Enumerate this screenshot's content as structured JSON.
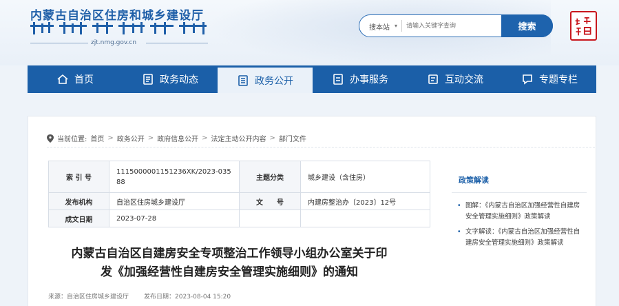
{
  "header": {
    "site_title": "内蒙古自治区住房和城乡建设厅",
    "site_url": "zjt.nmg.gov.cn",
    "seal_text": "内蒙古"
  },
  "search": {
    "scope_label": "搜本站",
    "placeholder": "请输入关键字查询",
    "button_label": "搜索"
  },
  "nav": {
    "items": [
      {
        "label": "首页",
        "icon": "home-icon"
      },
      {
        "label": "政务动态",
        "icon": "document-icon"
      },
      {
        "label": "政务公开",
        "icon": "list-document-icon",
        "active": true
      },
      {
        "label": "办事服务",
        "icon": "service-icon"
      },
      {
        "label": "互动交流",
        "icon": "chat-icon"
      },
      {
        "label": "专题专栏",
        "icon": "topic-icon"
      }
    ]
  },
  "breadcrumb": {
    "prefix": "当前位置:",
    "items": [
      "首页",
      "政务公开",
      "政府信息公开",
      "法定主动公开内容",
      "部门文件"
    ]
  },
  "meta_table": {
    "index_label": "索 引 号",
    "index_value_line1": "1115000001151236XK/2023-035",
    "index_value_line2": "88",
    "category_label": "主题分类",
    "category_value": "城乡建设（含住房）",
    "issuer_label": "发布机构",
    "issuer_value": "自治区住房城乡建设厅",
    "docno_label": "文　　号",
    "docno_value": "内建房整治办〔2023〕12号",
    "date_label": "成文日期",
    "date_value": "2023-07-28"
  },
  "document": {
    "title_line1": "内蒙古自治区自建房安全专项整治工作领导小组办公室关于印",
    "title_line2": "发《加强经营性自建房安全管理实施细则》的通知",
    "source": "来源：自治区住房城乡建设厅",
    "published": "发布日期：2023-08-04 15:20"
  },
  "sidebar": {
    "title": "政策解读",
    "items": [
      "图解：《内蒙古自治区加强经营性自建房安全管理实施细则》政策解读",
      "文字解读：《内蒙古自治区加强经营性自建房安全管理实施细则》政策解读"
    ]
  },
  "colors": {
    "primary": "#1b5fa8",
    "seal_red": "#c8161d"
  }
}
